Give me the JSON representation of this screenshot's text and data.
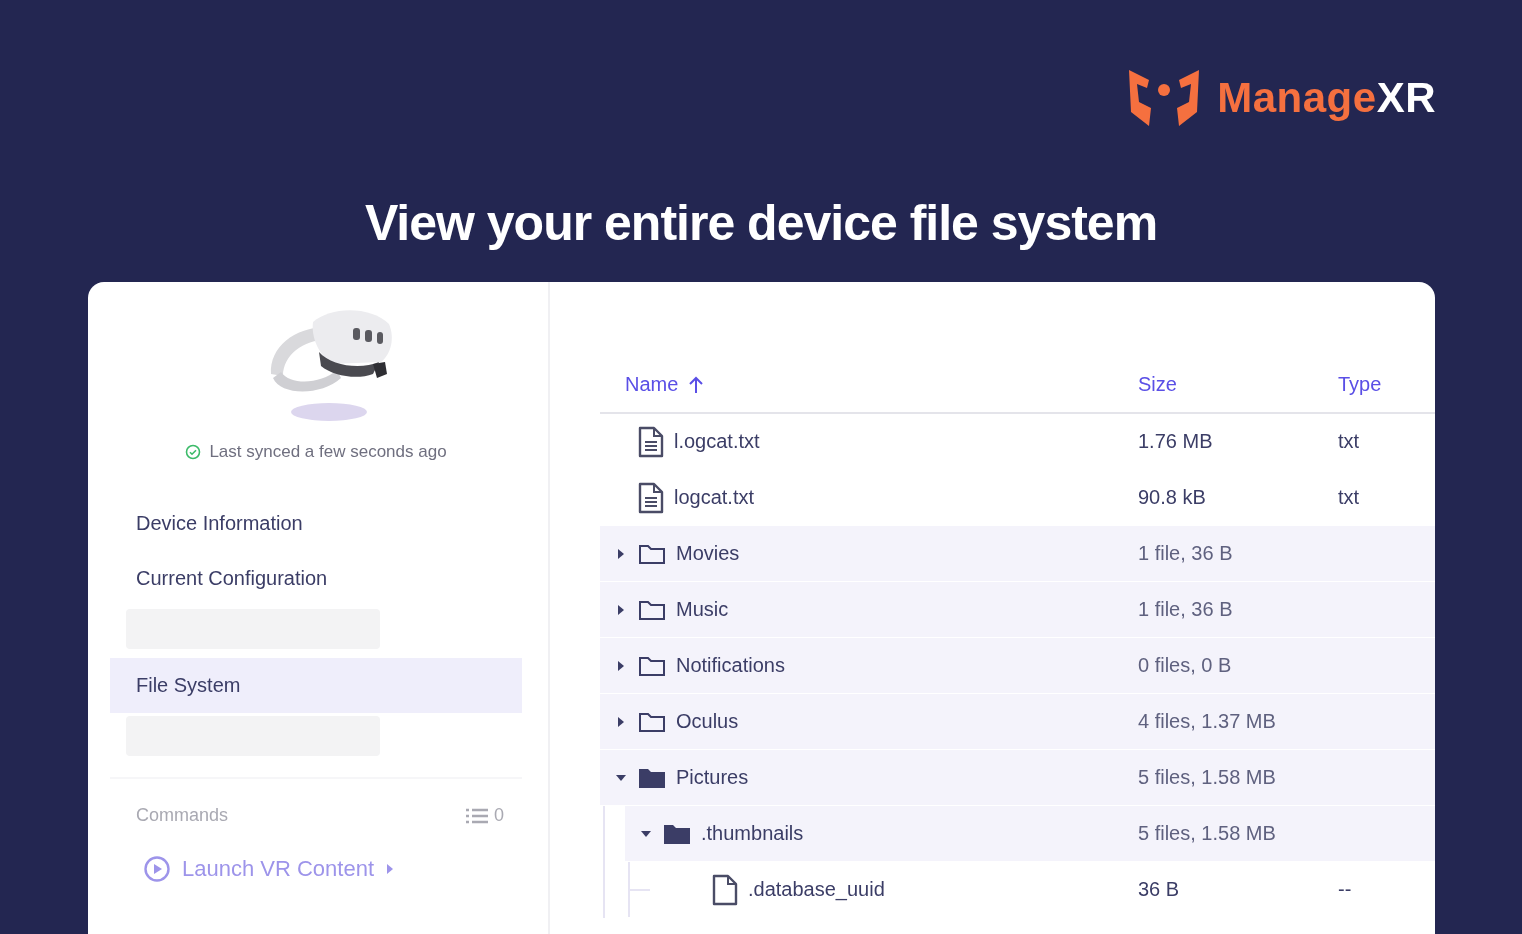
{
  "logo": {
    "brand": "Manage",
    "suffix": "XR"
  },
  "headline": "View your entire device file system",
  "sidebar": {
    "sync_status": "Last synced a few seconds ago",
    "nav": [
      {
        "kind": "link",
        "label": "Device Information",
        "selected": false
      },
      {
        "kind": "link",
        "label": "Current Configuration",
        "selected": false
      },
      {
        "kind": "placeholder"
      },
      {
        "kind": "link",
        "label": "File System",
        "selected": true
      },
      {
        "kind": "placeholder"
      }
    ],
    "commands": {
      "title": "Commands",
      "count": "0",
      "items": [
        {
          "label": "Launch VR Content"
        }
      ]
    }
  },
  "file_table": {
    "columns": [
      {
        "label": "Name",
        "sorted": true
      },
      {
        "label": "Size",
        "sorted": false
      },
      {
        "label": "Type",
        "sorted": false
      }
    ],
    "rows": [
      {
        "kind": "file",
        "name": "l.ogcat.txt",
        "size": "1.76 MB",
        "type": "txt"
      },
      {
        "kind": "file",
        "name": "logcat.txt",
        "size": "90.8 kB",
        "type": "txt"
      },
      {
        "kind": "folder",
        "name": "Movies",
        "size": "1 file, 36 B",
        "expanded": false
      },
      {
        "kind": "folder",
        "name": "Music",
        "size": "1 file, 36 B",
        "expanded": false
      },
      {
        "kind": "folder",
        "name": "Notifications",
        "size": "0 files, 0 B",
        "expanded": false
      },
      {
        "kind": "folder",
        "name": "Oculus",
        "size": "4 files, 1.37 MB",
        "expanded": false
      },
      {
        "kind": "folder",
        "name": "Pictures",
        "size": "5 files, 1.58 MB",
        "expanded": true,
        "children": [
          {
            "kind": "folder",
            "name": ".thumbnails",
            "size": "5 files, 1.58 MB",
            "expanded": true,
            "children": [
              {
                "kind": "file",
                "name": ".database_uuid",
                "size": "36 B",
                "type": "--"
              }
            ]
          }
        ]
      }
    ]
  }
}
